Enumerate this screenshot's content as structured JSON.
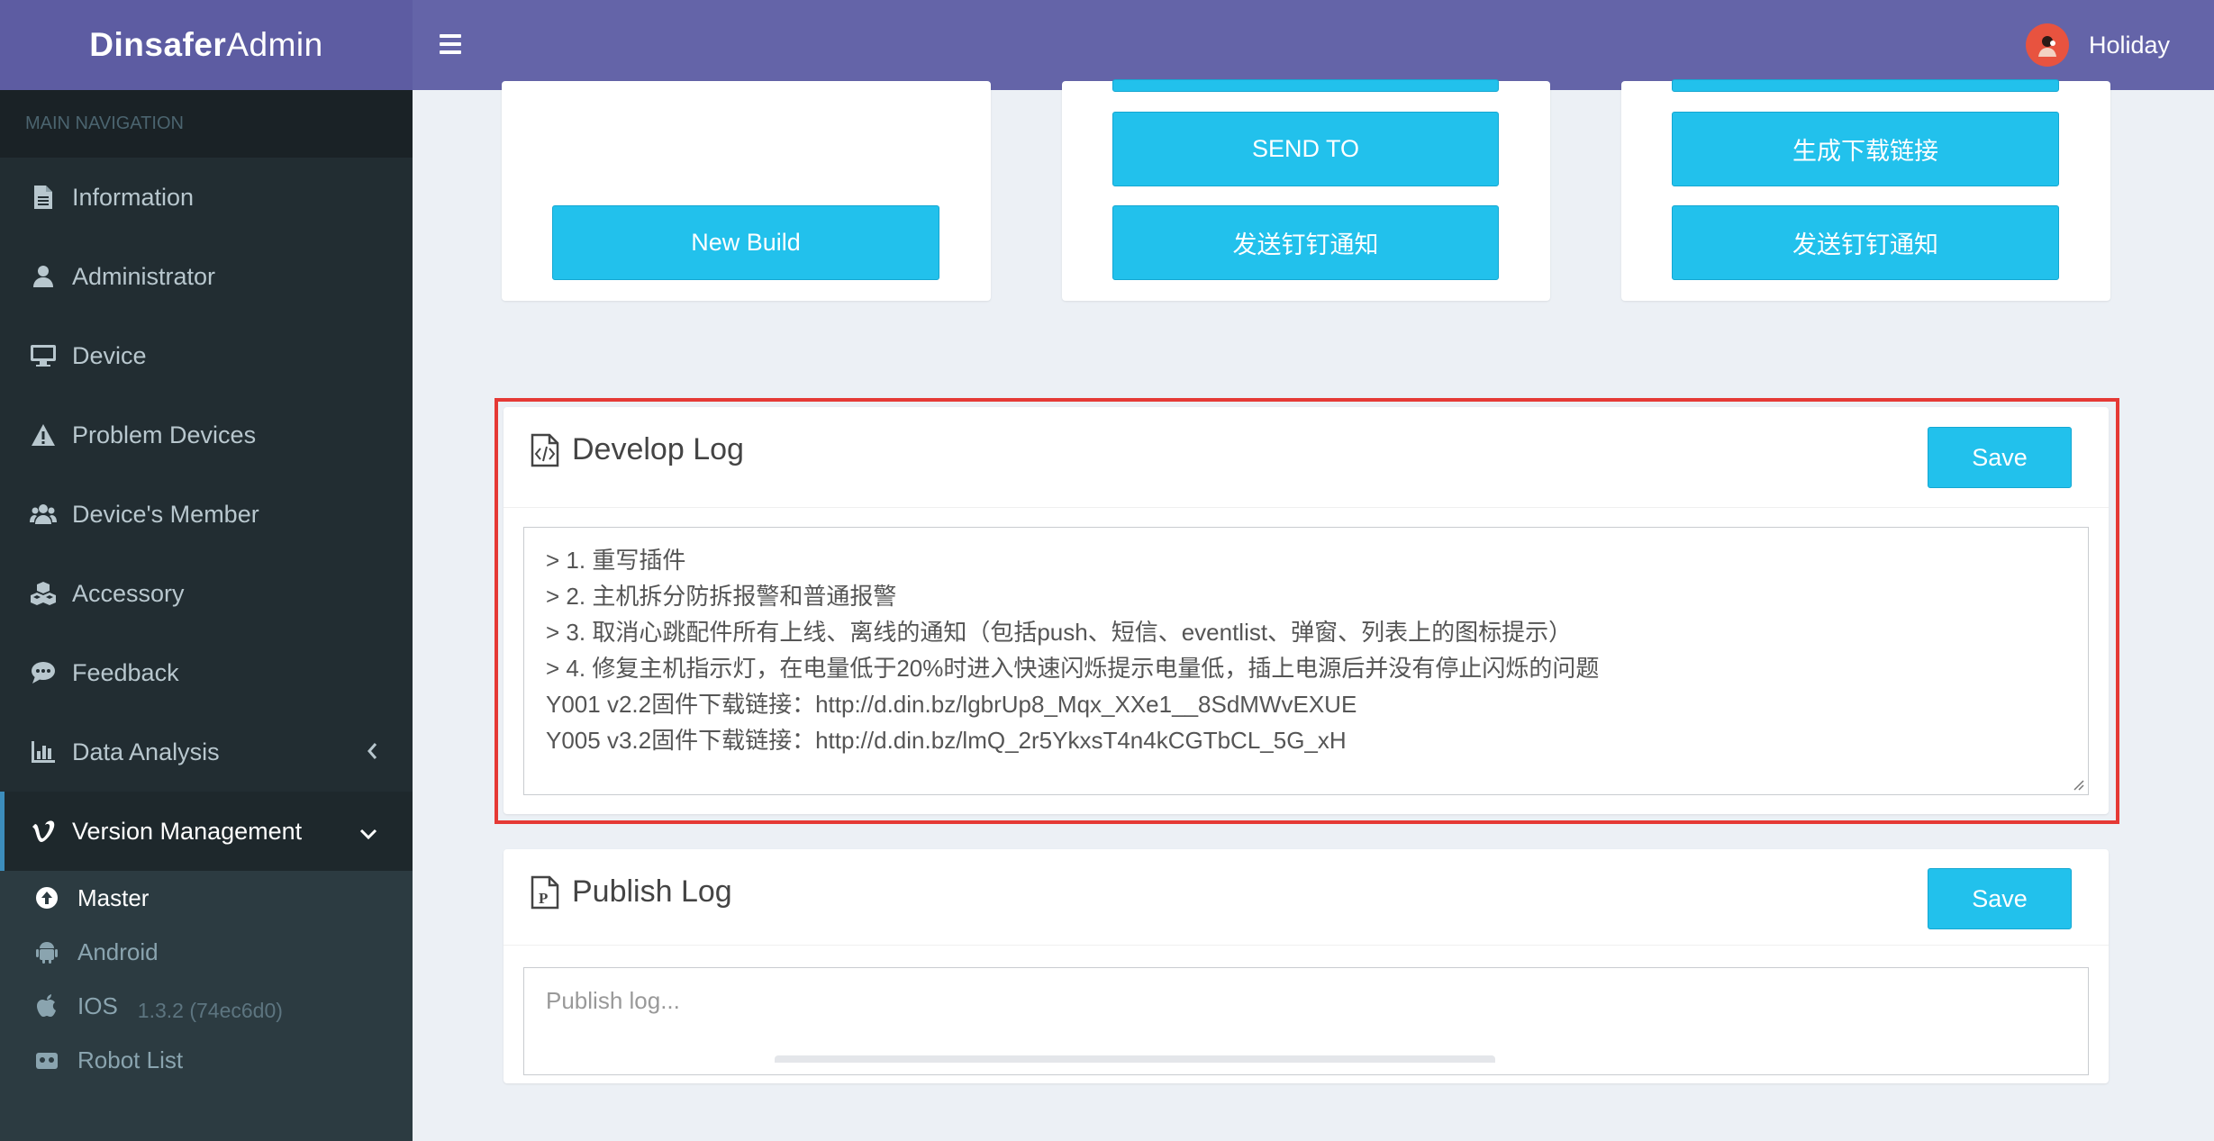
{
  "app": {
    "brand_bold": "Dinsafer",
    "brand_light": "Admin",
    "user_name": "Holiday"
  },
  "sidebar": {
    "header": "MAIN NAVIGATION",
    "items": [
      {
        "label": "Information",
        "icon": "file-text-icon"
      },
      {
        "label": "Administrator",
        "icon": "user-icon"
      },
      {
        "label": "Device",
        "icon": "desktop-icon"
      },
      {
        "label": "Problem Devices",
        "icon": "warning-icon"
      },
      {
        "label": "Device's Member",
        "icon": "users-icon"
      },
      {
        "label": "Accessory",
        "icon": "cubes-icon"
      },
      {
        "label": "Feedback",
        "icon": "comment-icon"
      },
      {
        "label": "Data Analysis",
        "icon": "bar-chart-icon"
      },
      {
        "label": "Version Management",
        "icon": "vimeo-icon"
      }
    ],
    "sub_items": [
      {
        "label": "Master",
        "icon": "arrow-circle-up-icon"
      },
      {
        "label": "Android",
        "icon": "android-icon"
      },
      {
        "label": "IOS",
        "icon": "apple-icon",
        "version": "1.3.2 (74ec6d0)"
      },
      {
        "label": "Robot List",
        "icon": "robot-icon"
      }
    ]
  },
  "build_cards": {
    "new_build": "New Build",
    "send_to": "SEND TO",
    "generate_link": "生成下载链接",
    "dingtalk_notify_1": "发送钉钉通知",
    "dingtalk_notify_2": "发送钉钉通知"
  },
  "develop_log": {
    "title": "Develop Log",
    "save_label": "Save",
    "content": "> 1. 重写插件\n> 2. 主机拆分防拆报警和普通报警\n> 3. 取消心跳配件所有上线、离线的通知（包括push、短信、eventlist、弹窗、列表上的图标提示）\n> 4. 修复主机指示灯，在电量低于20%时进入快速闪烁提示电量低，插上电源后并没有停止闪烁的问题\nY001 v2.2固件下载链接：http://d.din.bz/lgbrUp8_Mqx_XXe1__8SdMWvEXUE\nY005 v3.2固件下载链接：http://d.din.bz/lmQ_2r5YkxsT4n4kCGTbCL_5G_xH"
  },
  "publish_log": {
    "title": "Publish Log",
    "save_label": "Save",
    "placeholder": "Publish log..."
  },
  "colors": {
    "accent": "#22c1ec",
    "header": "#6464a8",
    "sidebar": "#222d32",
    "highlight": "#e53935"
  }
}
